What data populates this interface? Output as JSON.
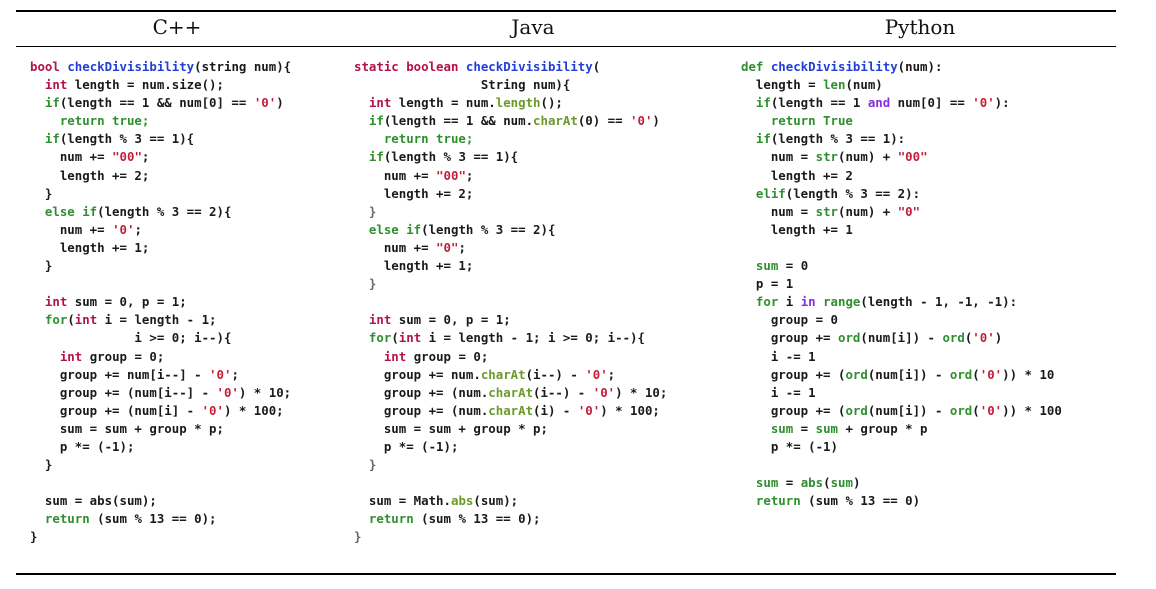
{
  "table": {
    "headers": [
      "C++",
      "Java",
      "Python"
    ],
    "colors": {
      "keyword": "#b3124a",
      "function": "#1f3fd6",
      "builtin": "#2f8f2f",
      "string": "#c0203a",
      "operator_kw": "#8a2be2",
      "method": "#6b9a2a",
      "plain": "#1a1a1a",
      "soft": "#666666"
    },
    "code": [
      {
        "language": "C++",
        "lines": [
          [
            [
              "bool ",
              "keyword"
            ],
            [
              "checkDivisibility",
              "function"
            ],
            [
              "(string num){",
              "plain"
            ]
          ],
          [
            [
              "  int ",
              "keyword"
            ],
            [
              "length = num.size();",
              "plain"
            ]
          ],
          [
            [
              "  if",
              "builtin"
            ],
            [
              "(length == 1 && num[0] == ",
              "plain"
            ],
            [
              "'0'",
              "string"
            ],
            [
              ")",
              "plain"
            ]
          ],
          [
            [
              "    return true;",
              "builtin"
            ]
          ],
          [
            [
              "  if",
              "builtin"
            ],
            [
              "(length % 3 == 1){",
              "plain"
            ]
          ],
          [
            [
              "    num += ",
              "plain"
            ],
            [
              "\"00\"",
              "string"
            ],
            [
              ";",
              "plain"
            ]
          ],
          [
            [
              "    length += 2;",
              "plain"
            ]
          ],
          [
            [
              "  }",
              "plain"
            ]
          ],
          [
            [
              "  else if",
              "builtin"
            ],
            [
              "(length % 3 == 2){",
              "plain"
            ]
          ],
          [
            [
              "    num += ",
              "plain"
            ],
            [
              "'0'",
              "string"
            ],
            [
              ";",
              "plain"
            ]
          ],
          [
            [
              "    length += 1;",
              "plain"
            ]
          ],
          [
            [
              "  }",
              "plain"
            ]
          ],
          [
            [
              "",
              "plain"
            ]
          ],
          [
            [
              "  int ",
              "keyword"
            ],
            [
              "sum = 0, p = 1;",
              "plain"
            ]
          ],
          [
            [
              "  for",
              "builtin"
            ],
            [
              "(",
              "plain"
            ],
            [
              "int ",
              "keyword"
            ],
            [
              "i = length - 1;",
              "plain"
            ]
          ],
          [
            [
              "              i >= 0; i--){",
              "plain"
            ]
          ],
          [
            [
              "    int ",
              "keyword"
            ],
            [
              "group = 0;",
              "plain"
            ]
          ],
          [
            [
              "    group += num[i--] - ",
              "plain"
            ],
            [
              "'0'",
              "string"
            ],
            [
              ";",
              "plain"
            ]
          ],
          [
            [
              "    group += (num[i--] - ",
              "plain"
            ],
            [
              "'0'",
              "string"
            ],
            [
              ") * 10;",
              "plain"
            ]
          ],
          [
            [
              "    group += (num[i] - ",
              "plain"
            ],
            [
              "'0'",
              "string"
            ],
            [
              ") * 100;",
              "plain"
            ]
          ],
          [
            [
              "    sum = sum + group * p;",
              "plain"
            ]
          ],
          [
            [
              "    p *= (-1);",
              "plain"
            ]
          ],
          [
            [
              "  }",
              "plain"
            ]
          ],
          [
            [
              "",
              "plain"
            ]
          ],
          [
            [
              "  sum = abs(sum);",
              "plain"
            ]
          ],
          [
            [
              "  return ",
              "builtin"
            ],
            [
              "(sum % 13 == 0);",
              "plain"
            ]
          ],
          [
            [
              "}",
              "plain"
            ]
          ]
        ]
      },
      {
        "language": "Java",
        "lines": [
          [
            [
              "static boolean ",
              "keyword"
            ],
            [
              "checkDivisibility",
              "function"
            ],
            [
              "(",
              "plain"
            ]
          ],
          [
            [
              "                 String num){",
              "plain"
            ]
          ],
          [
            [
              "  int ",
              "keyword"
            ],
            [
              "length = num.",
              "plain"
            ],
            [
              "length",
              "method"
            ],
            [
              "();",
              "plain"
            ]
          ],
          [
            [
              "  if",
              "builtin"
            ],
            [
              "(length == 1 && num.",
              "plain"
            ],
            [
              "charAt",
              "method"
            ],
            [
              "(0) == ",
              "plain"
            ],
            [
              "'0'",
              "string"
            ],
            [
              ")",
              "plain"
            ]
          ],
          [
            [
              "    return true;",
              "builtin"
            ]
          ],
          [
            [
              "  if",
              "builtin"
            ],
            [
              "(length % 3 == 1){",
              "plain"
            ]
          ],
          [
            [
              "    num += ",
              "plain"
            ],
            [
              "\"00\"",
              "string"
            ],
            [
              ";",
              "plain"
            ]
          ],
          [
            [
              "    length += 2;",
              "plain"
            ]
          ],
          [
            [
              "  }",
              "soft"
            ]
          ],
          [
            [
              "  else if",
              "builtin"
            ],
            [
              "(length % 3 == 2){",
              "plain"
            ]
          ],
          [
            [
              "    num += ",
              "plain"
            ],
            [
              "\"0\"",
              "string"
            ],
            [
              ";",
              "plain"
            ]
          ],
          [
            [
              "    length += 1;",
              "plain"
            ]
          ],
          [
            [
              "  }",
              "soft"
            ]
          ],
          [
            [
              "",
              "plain"
            ]
          ],
          [
            [
              "  int ",
              "keyword"
            ],
            [
              "sum = 0, p = 1;",
              "plain"
            ]
          ],
          [
            [
              "  for",
              "builtin"
            ],
            [
              "(",
              "plain"
            ],
            [
              "int ",
              "keyword"
            ],
            [
              "i = length - 1; i >= 0; i--){",
              "plain"
            ]
          ],
          [
            [
              "    int ",
              "keyword"
            ],
            [
              "group = 0;",
              "plain"
            ]
          ],
          [
            [
              "    group += num.",
              "plain"
            ],
            [
              "charAt",
              "method"
            ],
            [
              "(i--) - ",
              "plain"
            ],
            [
              "'0'",
              "string"
            ],
            [
              ";",
              "plain"
            ]
          ],
          [
            [
              "    group += (num.",
              "plain"
            ],
            [
              "charAt",
              "method"
            ],
            [
              "(i--) - ",
              "plain"
            ],
            [
              "'0'",
              "string"
            ],
            [
              ") * 10;",
              "plain"
            ]
          ],
          [
            [
              "    group += (num.",
              "plain"
            ],
            [
              "charAt",
              "method"
            ],
            [
              "(i) - ",
              "plain"
            ],
            [
              "'0'",
              "string"
            ],
            [
              ") * 100;",
              "plain"
            ]
          ],
          [
            [
              "    sum = sum + group * p;",
              "plain"
            ]
          ],
          [
            [
              "    p *= (-1);",
              "plain"
            ]
          ],
          [
            [
              "  }",
              "soft"
            ]
          ],
          [
            [
              "",
              "plain"
            ]
          ],
          [
            [
              "  sum = Math.",
              "plain"
            ],
            [
              "abs",
              "method"
            ],
            [
              "(sum);",
              "plain"
            ]
          ],
          [
            [
              "  return ",
              "builtin"
            ],
            [
              "(sum % 13 == 0);",
              "plain"
            ]
          ],
          [
            [
              "}",
              "soft"
            ]
          ]
        ]
      },
      {
        "language": "Python",
        "lines": [
          [
            [
              "def ",
              "builtin"
            ],
            [
              "checkDivisibility",
              "function"
            ],
            [
              "(num):",
              "plain"
            ]
          ],
          [
            [
              "  length = ",
              "plain"
            ],
            [
              "len",
              "builtin"
            ],
            [
              "(num)",
              "plain"
            ]
          ],
          [
            [
              "  if",
              "builtin"
            ],
            [
              "(length == 1 ",
              "plain"
            ],
            [
              "and",
              "operator_kw"
            ],
            [
              " num[0] == ",
              "plain"
            ],
            [
              "'0'",
              "string"
            ],
            [
              "):",
              "plain"
            ]
          ],
          [
            [
              "    return True",
              "builtin"
            ]
          ],
          [
            [
              "  if",
              "builtin"
            ],
            [
              "(length % 3 == 1):",
              "plain"
            ]
          ],
          [
            [
              "    num = ",
              "plain"
            ],
            [
              "str",
              "builtin"
            ],
            [
              "(num) + ",
              "plain"
            ],
            [
              "\"00\"",
              "string"
            ]
          ],
          [
            [
              "    length += 2",
              "plain"
            ]
          ],
          [
            [
              "  elif",
              "builtin"
            ],
            [
              "(length % 3 == 2):",
              "plain"
            ]
          ],
          [
            [
              "    num = ",
              "plain"
            ],
            [
              "str",
              "builtin"
            ],
            [
              "(num) + ",
              "plain"
            ],
            [
              "\"0\"",
              "string"
            ]
          ],
          [
            [
              "    length += 1",
              "plain"
            ]
          ],
          [
            [
              "",
              "plain"
            ]
          ],
          [
            [
              "  sum",
              "builtin"
            ],
            [
              " = 0",
              "plain"
            ]
          ],
          [
            [
              "  p = 1",
              "plain"
            ]
          ],
          [
            [
              "  for ",
              "builtin"
            ],
            [
              "i ",
              "plain"
            ],
            [
              "in ",
              "operator_kw"
            ],
            [
              "range",
              "builtin"
            ],
            [
              "(length - 1, -1, -1):",
              "plain"
            ]
          ],
          [
            [
              "    group = 0",
              "plain"
            ]
          ],
          [
            [
              "    group += ",
              "plain"
            ],
            [
              "ord",
              "builtin"
            ],
            [
              "(num[i]) - ",
              "plain"
            ],
            [
              "ord",
              "builtin"
            ],
            [
              "(",
              "plain"
            ],
            [
              "'0'",
              "string"
            ],
            [
              ")",
              "plain"
            ]
          ],
          [
            [
              "    i -= 1",
              "plain"
            ]
          ],
          [
            [
              "    group += (",
              "plain"
            ],
            [
              "ord",
              "builtin"
            ],
            [
              "(num[i]) - ",
              "plain"
            ],
            [
              "ord",
              "builtin"
            ],
            [
              "(",
              "plain"
            ],
            [
              "'0'",
              "string"
            ],
            [
              ")) * 10",
              "plain"
            ]
          ],
          [
            [
              "    i -= 1",
              "plain"
            ]
          ],
          [
            [
              "    group += (",
              "plain"
            ],
            [
              "ord",
              "builtin"
            ],
            [
              "(num[i]) - ",
              "plain"
            ],
            [
              "ord",
              "builtin"
            ],
            [
              "(",
              "plain"
            ],
            [
              "'0'",
              "string"
            ],
            [
              ")) * 100",
              "plain"
            ]
          ],
          [
            [
              "    sum",
              "builtin"
            ],
            [
              " = ",
              "plain"
            ],
            [
              "sum",
              "builtin"
            ],
            [
              " + group * p",
              "plain"
            ]
          ],
          [
            [
              "    p *= (-1)",
              "plain"
            ]
          ],
          [
            [
              "",
              "plain"
            ]
          ],
          [
            [
              "  sum",
              "builtin"
            ],
            [
              " = ",
              "plain"
            ],
            [
              "abs",
              "builtin"
            ],
            [
              "(",
              "plain"
            ],
            [
              "sum",
              "builtin"
            ],
            [
              ")",
              "plain"
            ]
          ],
          [
            [
              "  return ",
              "builtin"
            ],
            [
              "(sum % 13 == 0)",
              "plain"
            ]
          ]
        ]
      }
    ]
  }
}
